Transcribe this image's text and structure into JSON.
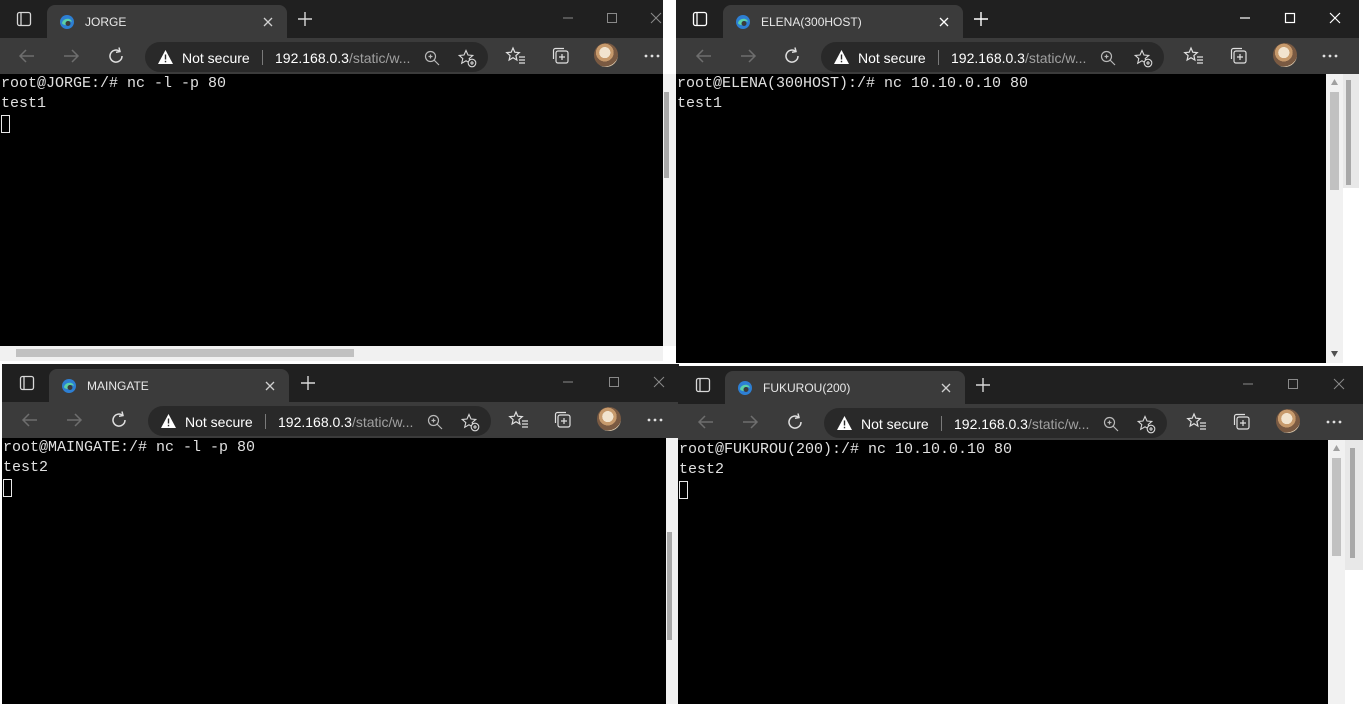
{
  "common": {
    "not_secure": "Not secure",
    "url_host": "192.168.0.3",
    "url_path": "/static/w..."
  },
  "windows": [
    {
      "tab_title": "JORGE",
      "lines": [
        "root@JORGE:/# nc -l -p 80",
        "test1"
      ],
      "cursor_line": 2
    },
    {
      "tab_title": "ELENA(300HOST)",
      "lines": [
        "root@ELENA(300HOST):/# nc 10.10.0.10 80",
        "test1"
      ],
      "cursor_line": null
    },
    {
      "tab_title": "MAINGATE",
      "lines": [
        "root@MAINGATE:/# nc -l -p 80",
        "test2"
      ],
      "cursor_line": 2
    },
    {
      "tab_title": "FUKUROU(200)",
      "lines": [
        "root@FUKUROU(200):/# nc 10.10.0.10 80",
        "test2"
      ],
      "cursor_line": 2
    }
  ],
  "colors": {
    "titlebar": "#202020",
    "toolbar": "#3b3b3b",
    "omnibox": "#292929",
    "terminal_bg": "#000000",
    "terminal_fg": "#e0e0e0"
  }
}
